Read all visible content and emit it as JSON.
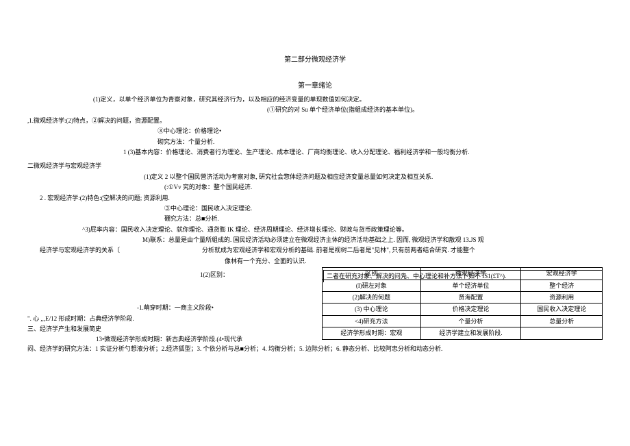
{
  "titles": {
    "main": "第二部分微观经济学",
    "chapter": "第一章绪论"
  },
  "p1": {
    "l1": "(1)定义，以单个经济单位为青察对象，研究其经济行为，以及相应的经济变量的单现数值如何决定。",
    "l2": "(①研究的对 Su 单个经济单位(指組成经济的基本单位)。",
    "l3": ",1.微观经济学:(2)特点，②解决的问题，资源配置。",
    "l4": "③中心理论：价格理论•",
    "l5": "砌究方法：个量分析.",
    "l6": "1    (3)基本内容：价格理论、消费者行为理论、生产理论、成本理论、厂商均衡理论、收入分配理论、福利经济学和一般均衡分析."
  },
  "p2": {
    "heading": "二微观经济学与宏观经济学",
    "l1": "(1)定义 2 以整个国民營济活动为考察对象, 研究社会惣体经济问题及相应经济变量总量如何决定及相互关系.",
    "l2": "(:①Vv 究的对象：整个国民经济.",
    "l3": "2 . 宏观经济学:(2)特色:(空解决的问题; 资源利用.",
    "l4": "③中心理论：国民收入决定理论.",
    "l5": "硼究方法：总■分析.",
    "l6": "^3)屁率内容：国民收入决定理论、就你理论、通货膨 IK 理论、经济周期理论、经济增长理论、财政与货币政策理论等。",
    "l7a": "M)联系：总量是由个量所組成的. 国民经济活动必须建立在微观经济主体的经济活动基础之上. 因而, 微观经济学和散观 13.JS 观",
    "l7b_left": "经济学与宏观经济学的关系〔",
    "l7b_right": "分析就成为宏观经济学和宏观分析的基础. 前者是视树二后者是\"见林\", 只有前两者结合研究. 才能整个",
    "l7c": "像林有一个充分、全面的认识."
  },
  "table": {
    "caption_l": "1(2)区别：",
    "caption_r": "二者在研充对象、解决的问凫、中心理论和补方法卜如不 IS1(£T^).",
    "h1": "区别",
    "h2": "微观经济学",
    "h3": "宏观经济学",
    "r1c1": "(I)研左对象",
    "r1c2": "单个经济单位",
    "r1c3": "整个经济",
    "r2c1": "(2)解决的何题",
    "r2c2": "贤海配置",
    "r2c3": "资源利用",
    "r3c1": "(3) 中心理论",
    "r3c2": "价格决定理论",
    "r3c3": "国民收入决定理论",
    "r4c1": "<4)研充方法",
    "r4c2": "个量分析",
    "r4c3": "总量分析",
    "r5c1": "经济学形成时期：宏观",
    "r5c2": "经济学建立和发展阶段.",
    "r5c3": ""
  },
  "left_block": {
    "l1": "-1.萌穿时期：一商主义阶段•",
    "l2": "\". 心 ,,,E/12 形成时期：占典经济学阶段.",
    "l3": "三、经济学产生和发展简史",
    "l4": "13•微观经济学形成时期：新古典经济学阶段.(4•现代承"
  },
  "bottom": {
    "l1": "闷、经济学的研究方法：1 实证分析勺想液分析；2.经济狐型；3. 个依分析与总■分析；4. 均衡分析；5. 边际分析；6. 静态分析、比较阿忠分析和动态分析."
  }
}
